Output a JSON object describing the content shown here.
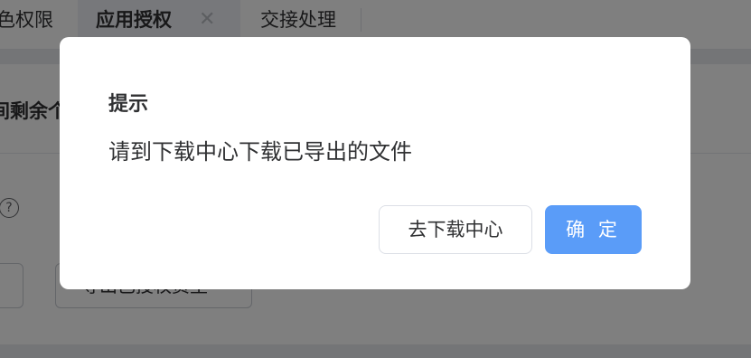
{
  "tabs": [
    {
      "label": "色权限"
    },
    {
      "label": "应用授权",
      "active": true,
      "close_icon": "close-icon"
    },
    {
      "label": "交接处理"
    }
  ],
  "background": {
    "section_title": "间剩余个",
    "help_icon": "question-circle-icon",
    "help_glyph": "?",
    "left_button_label": "",
    "export_button_label": "导出已授权资里"
  },
  "dialog": {
    "title": "提示",
    "message": "请到下载中心下载已导出的文件",
    "secondary_button": "去下载中心",
    "primary_button": "确 定"
  },
  "colors": {
    "primary": "#5a9cf8",
    "overlay": "rgba(0,0,0,0.5)",
    "text": "#303133"
  }
}
